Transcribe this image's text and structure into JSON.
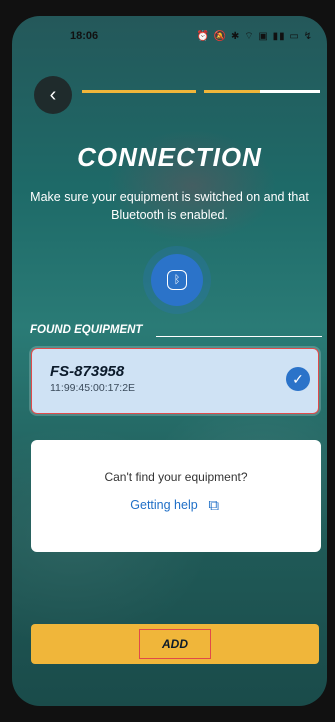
{
  "status_bar": {
    "time": "18:06",
    "icons": "⏰ 🔕 ✱ ⌔ ▣ ▮▮ ▭ ↯"
  },
  "header": {
    "back_icon": "chevron-left-icon"
  },
  "connection": {
    "title": "CONNECTION",
    "subtitle": "Make sure your equipment is switched on and that Bluetooth is enabled.",
    "bluetooth_icon": "bluetooth-icon"
  },
  "found": {
    "label": "FOUND EQUIPMENT",
    "devices": [
      {
        "name": "FS-873958",
        "mac": "11:99:45:00:17:2E",
        "selected": true
      }
    ]
  },
  "help": {
    "text": "Can't find your equipment?",
    "link": "Getting help"
  },
  "footer": {
    "add_label": "ADD"
  },
  "colors": {
    "accent": "#f0b63a",
    "primary": "#2b73c9",
    "link": "#1f6fc7"
  }
}
